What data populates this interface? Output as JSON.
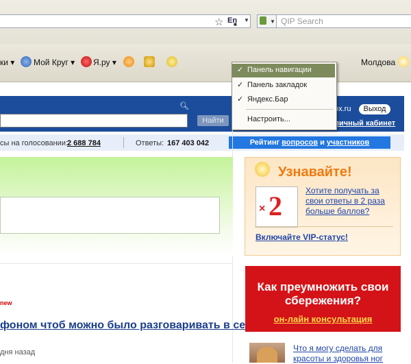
{
  "browser": {
    "lang": "En",
    "search_placeholder": "QIP Search"
  },
  "bookmarks": {
    "items": [
      {
        "label": "ки ▾"
      },
      {
        "label": "Мой Круг ▾"
      },
      {
        "label": "Я.ру ▾"
      },
      {
        "label": "Молдова"
      }
    ]
  },
  "menu": {
    "items": [
      {
        "label": "Панель навигации",
        "checked": "✓"
      },
      {
        "label": "Панель закладок",
        "checked": "✓"
      },
      {
        "label": "Яндекс.Бар",
        "checked": "✓"
      },
      {
        "label": "Настроить...",
        "checked": ""
      }
    ]
  },
  "header": {
    "find_label": "Найти",
    "mail_text": "ox.ru",
    "exit_label": "Выход",
    "cabinet_label": "личный кабинет"
  },
  "stats": {
    "voting_label": "сы на голосовании:",
    "voting_value": "2 688 784",
    "answers_label": "Ответы:",
    "answers_value": "167 403 042",
    "rating_prefix": "Рейтинг",
    "rating_link1": "вопросов",
    "rating_mid": "и",
    "rating_link2": "участников"
  },
  "question": {
    "new_badge": "new",
    "title": "фоном чтоб можно было разговаривать в сети и",
    "time": "дня назад"
  },
  "promo": {
    "title": "Узнавайте!",
    "text": "Хотите получать за свои ответы в 2 раза больше баллов?",
    "x2_sign": "×",
    "x2_number": "2",
    "vip_link": "Включайте VIP-статус!"
  },
  "ad": {
    "title": "Как преумножить свои сбережения?",
    "link": "он-лайн консультация"
  },
  "teaser": {
    "text": "Что я могу сделать для красоты и здоровья ног"
  },
  "colors": {
    "header_blue": "#1b4d9c",
    "accent_orange": "#f07a10",
    "ad_red": "#d41318",
    "link_blue": "#1f44a8"
  }
}
